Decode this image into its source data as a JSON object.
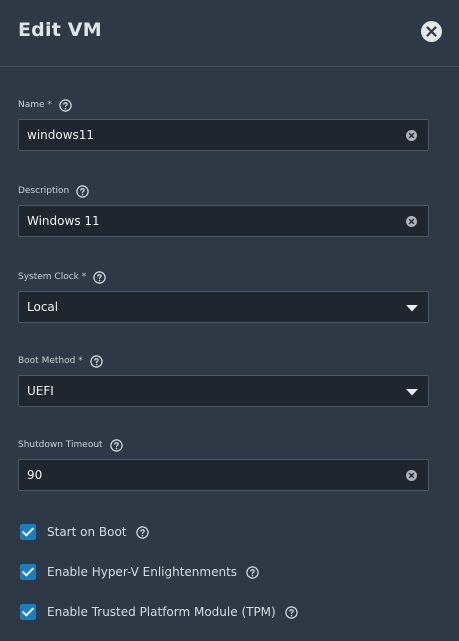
{
  "dialog": {
    "title": "Edit VM"
  },
  "fields": {
    "name": {
      "label": "Name *",
      "value": "windows11"
    },
    "description": {
      "label": "Description",
      "value": "Windows 11"
    },
    "system_clock": {
      "label": "System Clock *",
      "value": "Local"
    },
    "boot_method": {
      "label": "Boot Method *",
      "value": "UEFI"
    },
    "shutdown_timeout": {
      "label": "Shutdown Timeout",
      "value": "90"
    }
  },
  "checkboxes": {
    "start_on_boot": {
      "label": "Start on Boot",
      "checked": true
    },
    "hyperv": {
      "label": "Enable Hyper-V Enlightenments",
      "checked": true
    },
    "tpm": {
      "label": "Enable Trusted Platform Module (TPM)",
      "checked": true
    }
  },
  "colors": {
    "background": "#2f3945",
    "input_background": "#1f262d",
    "checkbox_accent": "#1b7fbf"
  },
  "icons": {
    "close": "close-icon",
    "help": "help-icon",
    "clear": "clear-icon",
    "dropdown": "chevron-down-icon",
    "check": "checkmark-icon"
  }
}
